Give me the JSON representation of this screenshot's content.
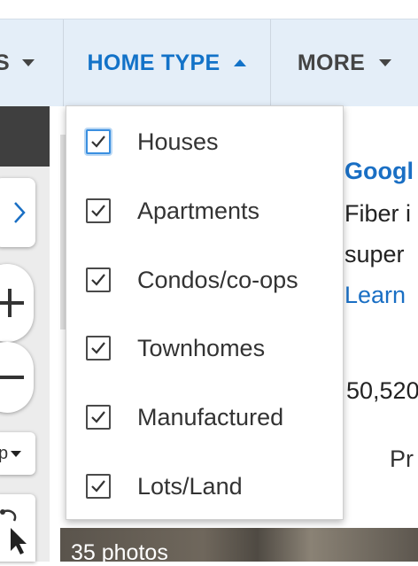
{
  "filter_bar": {
    "items": [
      {
        "label": "S"
      },
      {
        "label": "HOME TYPE"
      },
      {
        "label": "MORE"
      }
    ]
  },
  "home_type_menu": {
    "options": [
      {
        "label": "Houses",
        "checked": true
      },
      {
        "label": "Apartments",
        "checked": true
      },
      {
        "label": "Condos/co-ops",
        "checked": true
      },
      {
        "label": "Townhomes",
        "checked": true
      },
      {
        "label": "Manufactured",
        "checked": true
      },
      {
        "label": "Lots/Land",
        "checked": true
      }
    ]
  },
  "map_controls": {
    "layer_label": "p"
  },
  "ad": {
    "title": "Googl",
    "line1": "Fiber i",
    "line2": "super",
    "link": "Learn"
  },
  "listing": {
    "price": "50,520",
    "partial_text": "Pr",
    "photo_count": "35 photos"
  },
  "colors": {
    "accent": "#1272c8",
    "filter_bar_bg": "#e4eef8",
    "checkbox_focus": "#3a8fe0"
  }
}
